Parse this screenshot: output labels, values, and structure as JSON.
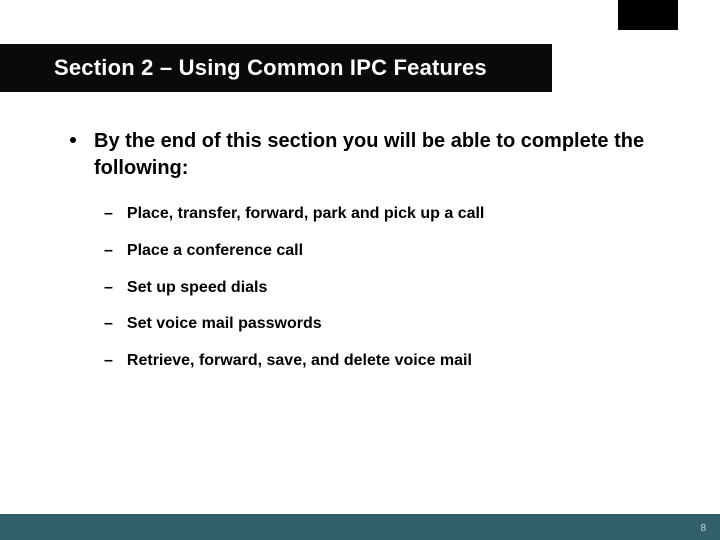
{
  "slide": {
    "title": "Section 2 – Using Common IPC Features",
    "lead": "By the end of this section you will be able to complete the following:",
    "items": [
      "Place, transfer, forward, park and pick up a call",
      "Place a conference call",
      "Set up speed dials",
      "Set voice mail passwords",
      "Retrieve, forward, save, and delete voice mail"
    ],
    "page_number": "8"
  }
}
